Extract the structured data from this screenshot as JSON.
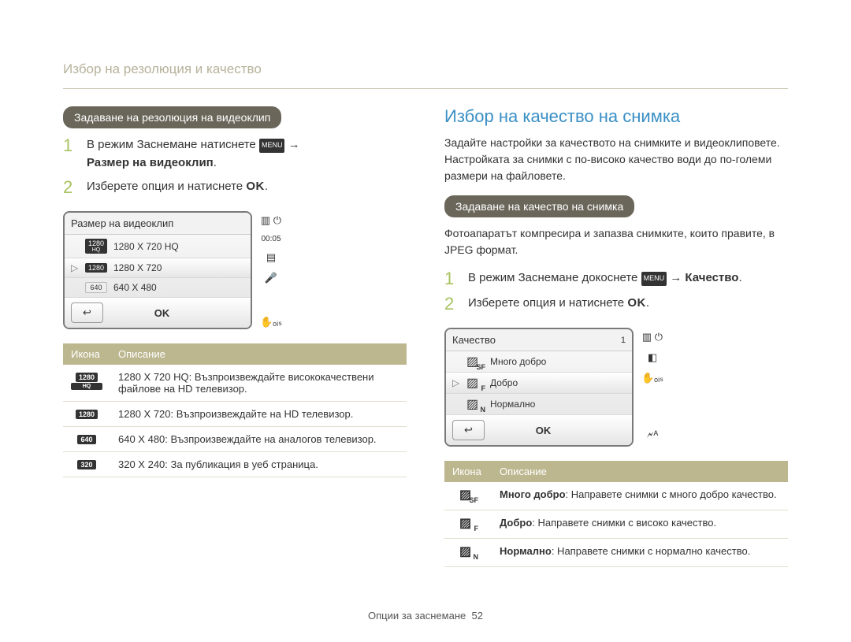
{
  "breadcrumb": "Избор на резолюция и качество",
  "left": {
    "pill": "Задаване на резолюция на видеоклип",
    "step1_a": "В режим Заснемане натиснете ",
    "step1_menu": "MENU",
    "step1_arrow": " → ",
    "step1_b": "Размер на видеоклип",
    "step2_a": "Изберете опция и натиснете ",
    "step2_ok": "OK",
    "lcd_title": "Размер на видеоклип",
    "lcd_time": "00:05",
    "lcd_items": [
      {
        "tag": "1280",
        "tagSub": "HQ",
        "label": "1280 X 720 HQ",
        "selected": false
      },
      {
        "tag": "1280",
        "tagSub": "",
        "label": "1280 X 720",
        "selected": true
      },
      {
        "tag": "640",
        "tagSub": "",
        "label": "640 X 480",
        "selected": false,
        "light": true
      }
    ],
    "lcd_back": "↩",
    "lcd_okbtn": "OK",
    "side_icons": [
      "▥ ⏻",
      "⧉",
      "▤",
      "🎤",
      "",
      "✋ₒᵢₛ"
    ],
    "table": {
      "head_icon": "Икона",
      "head_desc": "Описание",
      "rows": [
        {
          "icon": "1280",
          "iconSub": "HQ",
          "desc": "1280 X 720 HQ: Възпроизвеждайте висококачествени файлове на HD телевизор."
        },
        {
          "icon": "1280",
          "iconSub": "",
          "desc": "1280 X 720: Възпроизвеждайте на HD телевизор."
        },
        {
          "icon": "640",
          "iconSub": "",
          "desc": "640 X 480: Възпроизвеждайте на аналогов телевизор."
        },
        {
          "icon": "320",
          "iconSub": "",
          "desc": "320 X 240: За публикация в уеб страница."
        }
      ]
    }
  },
  "right": {
    "heading": "Избор на качество на снимка",
    "intro": "Задайте настройки за качеството на снимките и видеоклиповете. Настройката за снимки с по-високо качество води до по-големи размери на файловете.",
    "pill": "Задаване на качество на снимка",
    "para2": "Фотоапаратът компресира и запазва снимките, които правите, в JPEG формат.",
    "step1_a": "В режим Заснемане докоснете ",
    "step1_menu": "MENU",
    "step1_arrow": " → ",
    "step1_b": "Качество",
    "step2_a": "Изберете опция и натиснете ",
    "step2_ok": "OK",
    "lcd_title": "Качество",
    "lcd_count": "1",
    "lcd_items": [
      {
        "sub": "SF",
        "label": "Много добро",
        "selected": false
      },
      {
        "sub": "F",
        "label": "Добро",
        "selected": true
      },
      {
        "sub": "N",
        "label": "Нормално",
        "selected": false
      }
    ],
    "lcd_back": "↩",
    "lcd_okbtn": "OK",
    "side_icons": [
      "▥ ⏻",
      "◧",
      "✋ₒᵢₛ",
      "",
      "",
      "🗲ᴬ"
    ],
    "table": {
      "head_icon": "Икона",
      "head_desc": "Описание",
      "rows": [
        {
          "sub": "SF",
          "strong": "Много добро",
          "rest": ": Направете снимки с много добро качество."
        },
        {
          "sub": "F",
          "strong": "Добро",
          "rest": ": Направете снимки с високо качество."
        },
        {
          "sub": "N",
          "strong": "Нормално",
          "rest": ": Направете снимки с нормално качество."
        }
      ]
    }
  },
  "footer": {
    "text": "Опции за заснемане",
    "page": "52"
  }
}
